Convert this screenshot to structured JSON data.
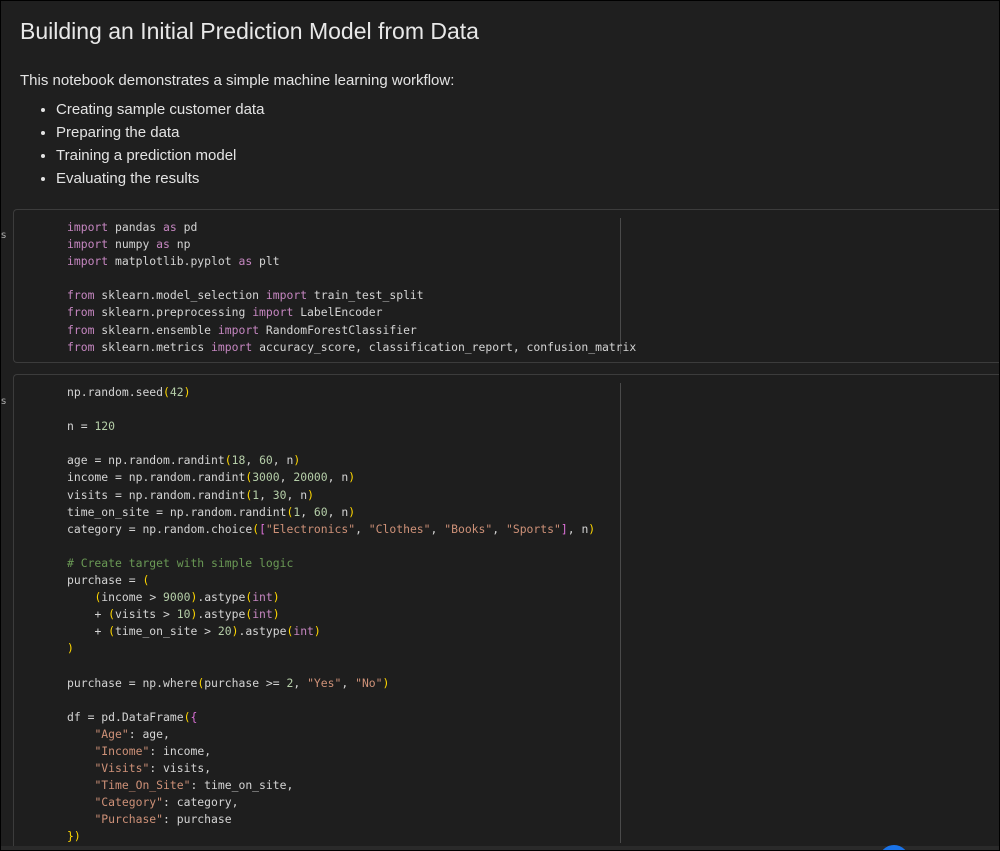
{
  "markdown": {
    "title": "Building an Initial Prediction Model from Data",
    "intro": "This notebook demonstrates a simple machine learning workflow:",
    "bullets": [
      "Creating sample customer data",
      "Preparing the data",
      "Training a prediction model",
      "Evaluating the results"
    ]
  },
  "cells": [
    {
      "gutter_label": "s",
      "lines": [
        "import pandas as pd",
        "import numpy as np",
        "import matplotlib.pyplot as plt",
        "",
        "from sklearn.model_selection import train_test_split",
        "from sklearn.preprocessing import LabelEncoder",
        "from sklearn.ensemble import RandomForestClassifier",
        "from sklearn.metrics import accuracy_score, classification_report, confusion_matrix"
      ]
    },
    {
      "gutter_label": "s",
      "lines": [
        "np.random.seed(42)",
        "",
        "n = 120",
        "",
        "age = np.random.randint(18, 60, n)",
        "income = np.random.randint(3000, 20000, n)",
        "visits = np.random.randint(1, 30, n)",
        "time_on_site = np.random.randint(1, 60, n)",
        "category = np.random.choice([\"Electronics\", \"Clothes\", \"Books\", \"Sports\"], n)",
        "",
        "# Create target with simple logic",
        "purchase = (",
        "    (income > 9000).astype(int)",
        "    + (visits > 10).astype(int)",
        "    + (time_on_site > 20).astype(int)",
        ")",
        "",
        "purchase = np.where(purchase >= 2, \"Yes\", \"No\")",
        "",
        "df = pd.DataFrame({",
        "    \"Age\": age,",
        "    \"Income\": income,",
        "    \"Visits\": visits,",
        "    \"Time_On_Site\": time_on_site,",
        "    \"Category\": category,",
        "    \"Purchase\": purchase",
        "})"
      ]
    }
  ]
}
